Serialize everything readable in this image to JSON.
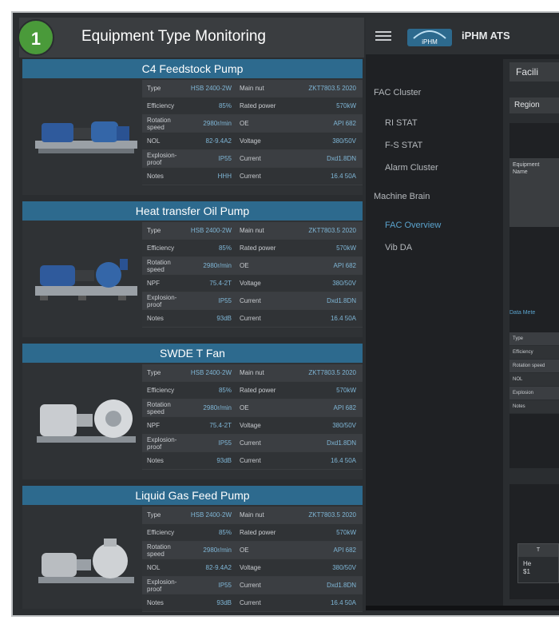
{
  "left_panel": {
    "badge": "1",
    "title": "Equipment Type Monitoring",
    "cards": [
      {
        "title": "C4 Feedstock Pump",
        "rows": [
          [
            "Type",
            "HSB 2400-2W",
            "Main nut",
            "ZKT7803.5 2020"
          ],
          [
            "Efficiency",
            "85%",
            "Rated power",
            "570kW"
          ],
          [
            "Rotation speed",
            "2980r/min",
            "OE",
            "API 682"
          ],
          [
            "NOL",
            "82-9.4A2",
            "Voltage",
            "380/50V"
          ],
          [
            "Explosion-proof",
            "IP55",
            "Current",
            "Dxd1.8DN"
          ],
          [
            "Notes",
            "HHH",
            "Current",
            "16.4 50A"
          ]
        ]
      },
      {
        "title": "Heat transfer Oil Pump",
        "rows": [
          [
            "Type",
            "HSB 2400-2W",
            "Main nut",
            "ZKT7803.5 2020"
          ],
          [
            "Efficiency",
            "85%",
            "Rated power",
            "570kW"
          ],
          [
            "Rotation speed",
            "2980r/min",
            "OE",
            "API 682"
          ],
          [
            "NPF",
            "75.4-2T",
            "Voltage",
            "380/50V"
          ],
          [
            "Explosion-proof",
            "IP55",
            "Current",
            "Dxd1.8DN"
          ],
          [
            "Notes",
            "93dB",
            "Current",
            "16.4 50A"
          ]
        ]
      },
      {
        "title": "SWDE T Fan",
        "rows": [
          [
            "Type",
            "HSB 2400-2W",
            "Main nut",
            "ZKT7803.5 2020"
          ],
          [
            "Efficiency",
            "85%",
            "Rated power",
            "570kW"
          ],
          [
            "Rotation speed",
            "2980r/min",
            "OE",
            "API 682"
          ],
          [
            "NPF",
            "75.4-2T",
            "Voltage",
            "380/50V"
          ],
          [
            "Explosion-proof",
            "IP55",
            "Current",
            "Dxd1.8DN"
          ],
          [
            "Notes",
            "93dB",
            "Current",
            "16.4 50A"
          ]
        ]
      },
      {
        "title": "Liquid Gas Feed Pump",
        "rows": [
          [
            "Type",
            "HSB 2400-2W",
            "Main nut",
            "ZKT7803.5 2020"
          ],
          [
            "Efficiency",
            "85%",
            "Rated power",
            "570kW"
          ],
          [
            "Rotation speed",
            "2980r/min",
            "OE",
            "API 682"
          ],
          [
            "NOL",
            "82-9.4A2",
            "Voltage",
            "380/50V"
          ],
          [
            "Explosion-proof",
            "IP55",
            "Current",
            "Dxd1.8DN"
          ],
          [
            "Notes",
            "93dB",
            "Current",
            "16.4 50A"
          ]
        ]
      }
    ]
  },
  "app": {
    "title": "iPHM ATS",
    "logo_text": "iPHM",
    "nav": {
      "fac_cluster": "FAC Cluster",
      "fac_items": [
        "RI STAT",
        "F-S STAT",
        "Alarm Cluster"
      ],
      "machine_brain": "Machine Brain",
      "mb_items": [
        "FAC Overview",
        "Vib DA"
      ]
    },
    "content": {
      "facility_button": "Facili",
      "region_button": "Region",
      "equip_label_1": "Equipment",
      "equip_label_2": "Name",
      "data_label": "Data Mete",
      "mini_rows": [
        "Type",
        "Efficiency",
        "Rotation speed",
        "NOL",
        "Explosion",
        "Notes"
      ],
      "popup_header": "T",
      "popup_line_1": "He",
      "popup_line_2": "$1"
    }
  },
  "colors": {
    "card_header": "#2d6a8e",
    "badge": "#4a9a3a",
    "value_text": "#7fb6d6",
    "nav_active": "#5aa2cc"
  }
}
